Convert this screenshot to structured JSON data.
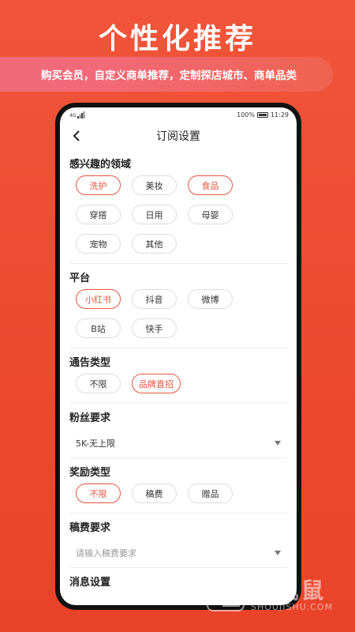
{
  "hero": {
    "title": "个性化推荐"
  },
  "banner": {
    "text": "购买会员，自定义商单推荐，定制探店城市、商单品类"
  },
  "status": {
    "battery": "100%",
    "time": "11:29",
    "network": "4G"
  },
  "nav": {
    "title": "订阅设置",
    "back_icon": "chevron-left-icon"
  },
  "interest": {
    "title": "感兴趣的领域",
    "tags": [
      {
        "label": "洗护",
        "selected": true
      },
      {
        "label": "美妆",
        "selected": false
      },
      {
        "label": "食品",
        "selected": true
      },
      {
        "label": "穿搭",
        "selected": false
      },
      {
        "label": "日用",
        "selected": false
      },
      {
        "label": "母婴",
        "selected": false
      },
      {
        "label": "宠物",
        "selected": false
      },
      {
        "label": "其他",
        "selected": false
      }
    ]
  },
  "platform": {
    "title": "平台",
    "tags": [
      {
        "label": "小红书",
        "selected": true
      },
      {
        "label": "抖音",
        "selected": false
      },
      {
        "label": "微博",
        "selected": false
      },
      {
        "label": "B站",
        "selected": false
      },
      {
        "label": "快手",
        "selected": false
      }
    ]
  },
  "ad_type": {
    "title": "通告类型",
    "tags": [
      {
        "label": "不限",
        "selected": false
      },
      {
        "label": "品牌直招",
        "selected": true
      }
    ]
  },
  "fans": {
    "title": "粉丝要求",
    "value": "5K-无上限"
  },
  "reward": {
    "title": "奖励类型",
    "tags": [
      {
        "label": "不限",
        "selected": true
      },
      {
        "label": "稿费",
        "selected": false
      },
      {
        "label": "赠品",
        "selected": false
      }
    ]
  },
  "fee": {
    "title": "稿费要求",
    "placeholder": "请输入稿费要求"
  },
  "message": {
    "title": "消息设置"
  },
  "watermark": {
    "text": "手机鼠",
    "sub": "SHOUJISHU.COM"
  },
  "colors": {
    "accent": "#e8553e",
    "background": "#ec4a2f"
  }
}
